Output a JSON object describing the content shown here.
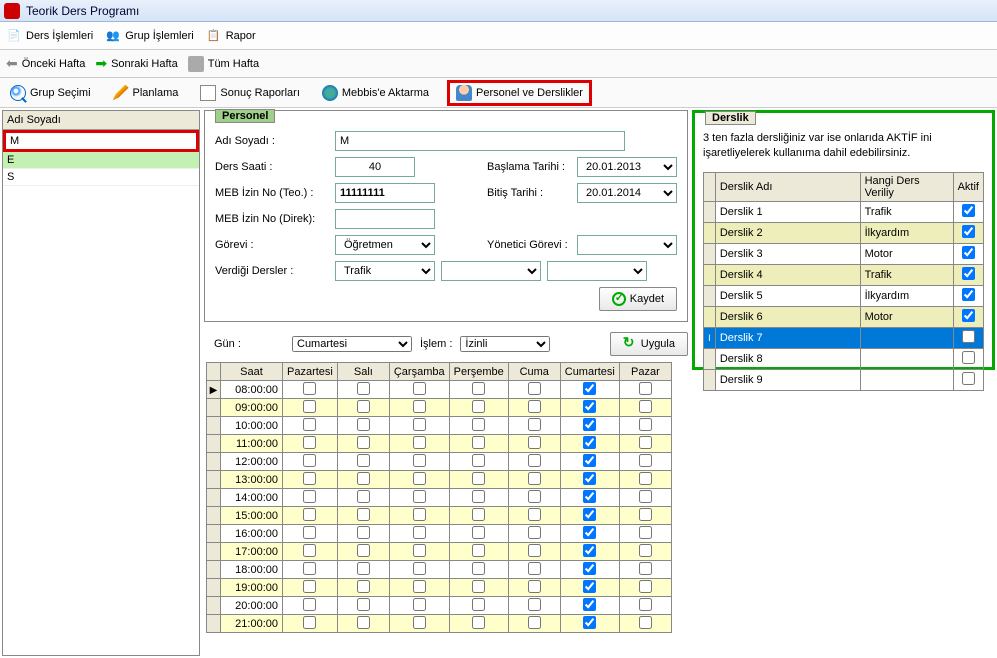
{
  "window": {
    "title": "Teorik Ders Programı"
  },
  "menubar": {
    "ders": "Ders İşlemleri",
    "grup": "Grup İşlemleri",
    "rapor": "Rapor"
  },
  "toolbar1": {
    "prev": "Önceki Hafta",
    "next": "Sonraki Hafta",
    "all": "Tüm Hafta"
  },
  "toolbar2": {
    "grup": "Grup Seçimi",
    "plan": "Planlama",
    "sonuc": "Sonuç Raporları",
    "mebbis": "Mebbis'e Aktarma",
    "personel": "Personel ve Derslikler"
  },
  "left": {
    "header": "Adı Soyadı",
    "rows": [
      "M",
      "E",
      "S"
    ]
  },
  "personel": {
    "title": "Personel",
    "labels": {
      "adi": "Adı Soyadı :",
      "saat": "Ders Saati :",
      "mebteo": "MEB İzin No (Teo.) :",
      "mebdirek": "MEB İzin No (Direk):",
      "gorev": "Görevi :",
      "verdigi": "Verdiği Dersler :",
      "baslama": "Başlama Tarihi :",
      "bitis": "Bitiş Tarihi :",
      "yonetici": "Yönetici Görevi :"
    },
    "values": {
      "adi": "M",
      "saat": "40",
      "mebteo": "11111111",
      "mebdirek": "",
      "gorev": "Öğretmen",
      "verdigi": "Trafik",
      "baslama": "20.01.2013",
      "bitis": "20.01.2014",
      "yonetici": ""
    },
    "kaydet": "Kaydet"
  },
  "gun": {
    "label": "Gün :",
    "value": "Cumartesi",
    "islem_label": "İşlem :",
    "islem_value": "İzinli",
    "uygula": "Uygula"
  },
  "schedule": {
    "headers": [
      "Saat",
      "Pazartesi",
      "Salı",
      "Çarşamba",
      "Perşembe",
      "Cuma",
      "Cumartesi",
      "Pazar"
    ],
    "rows": [
      {
        "time": "08:00:00",
        "yellow": false,
        "checks": [
          false,
          false,
          false,
          false,
          false,
          true,
          false
        ]
      },
      {
        "time": "09:00:00",
        "yellow": true,
        "checks": [
          false,
          false,
          false,
          false,
          false,
          true,
          false
        ]
      },
      {
        "time": "10:00:00",
        "yellow": false,
        "checks": [
          false,
          false,
          false,
          false,
          false,
          true,
          false
        ]
      },
      {
        "time": "11:00:00",
        "yellow": true,
        "checks": [
          false,
          false,
          false,
          false,
          false,
          true,
          false
        ]
      },
      {
        "time": "12:00:00",
        "yellow": false,
        "checks": [
          false,
          false,
          false,
          false,
          false,
          true,
          false
        ]
      },
      {
        "time": "13:00:00",
        "yellow": true,
        "checks": [
          false,
          false,
          false,
          false,
          false,
          true,
          false
        ]
      },
      {
        "time": "14:00:00",
        "yellow": false,
        "checks": [
          false,
          false,
          false,
          false,
          false,
          true,
          false
        ]
      },
      {
        "time": "15:00:00",
        "yellow": true,
        "checks": [
          false,
          false,
          false,
          false,
          false,
          true,
          false
        ]
      },
      {
        "time": "16:00:00",
        "yellow": false,
        "checks": [
          false,
          false,
          false,
          false,
          false,
          true,
          false
        ]
      },
      {
        "time": "17:00:00",
        "yellow": true,
        "checks": [
          false,
          false,
          false,
          false,
          false,
          true,
          false
        ]
      },
      {
        "time": "18:00:00",
        "yellow": false,
        "checks": [
          false,
          false,
          false,
          false,
          false,
          true,
          false
        ]
      },
      {
        "time": "19:00:00",
        "yellow": true,
        "checks": [
          false,
          false,
          false,
          false,
          false,
          true,
          false
        ]
      },
      {
        "time": "20:00:00",
        "yellow": false,
        "checks": [
          false,
          false,
          false,
          false,
          false,
          true,
          false
        ]
      },
      {
        "time": "21:00:00",
        "yellow": true,
        "checks": [
          false,
          false,
          false,
          false,
          false,
          true,
          false
        ]
      }
    ]
  },
  "derslik": {
    "title": "Derslik",
    "info": "3 ten fazla dersliğiniz var ise onlarıda AKTİF ini işaretliyelerek kullanıma dahil edebilirsiniz.",
    "headers": [
      "Derslik Adı",
      "Hangi Ders Veriliy",
      "Aktif"
    ],
    "rows": [
      {
        "name": "Derslik 1",
        "ders": "Trafik",
        "aktif": true,
        "style": ""
      },
      {
        "name": "Derslik 2",
        "ders": "İlkyardım",
        "aktif": true,
        "style": "yellow"
      },
      {
        "name": "Derslik 3",
        "ders": "Motor",
        "aktif": true,
        "style": ""
      },
      {
        "name": "Derslik 4",
        "ders": "Trafik",
        "aktif": true,
        "style": "yellow"
      },
      {
        "name": "Derslik 5",
        "ders": "İlkyardım",
        "aktif": true,
        "style": ""
      },
      {
        "name": "Derslik 6",
        "ders": "Motor",
        "aktif": true,
        "style": "yellow"
      },
      {
        "name": "Derslik 7",
        "ders": "",
        "aktif": false,
        "style": "blue"
      },
      {
        "name": "Derslik 8",
        "ders": "",
        "aktif": false,
        "style": ""
      },
      {
        "name": "Derslik 9",
        "ders": "",
        "aktif": false,
        "style": ""
      }
    ]
  }
}
